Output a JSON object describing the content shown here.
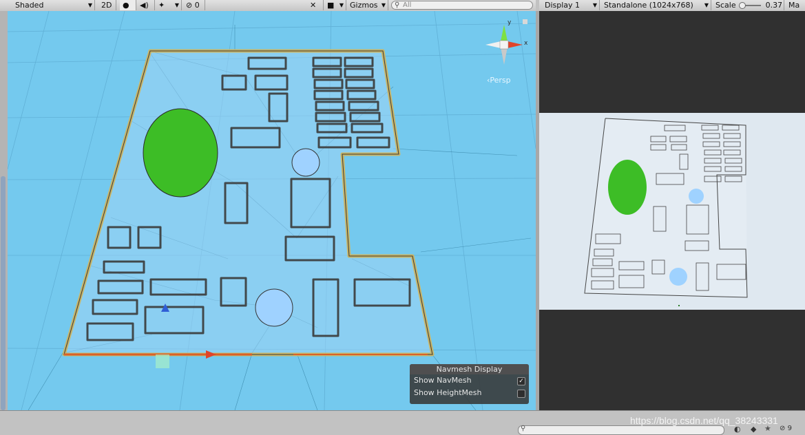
{
  "toolbar": {
    "shading_mode": "Shaded",
    "mode_2d": "2D",
    "hidden_count": "0",
    "gizmos_label": "Gizmos",
    "search_placeholder": "All"
  },
  "game_toolbar": {
    "display": "Display 1",
    "resolution": "Standalone (1024x768)",
    "scale_label": "Scale",
    "scale_value": "0.37",
    "maximize_label": "Ma"
  },
  "scene": {
    "persp_label": "Persp",
    "axis_x": "x",
    "axis_y": "y"
  },
  "navmesh_overlay": {
    "title": "Navmesh Display",
    "show_navmesh_label": "Show NavMesh",
    "show_navmesh_checked": true,
    "show_heightmesh_label": "Show HeightMesh",
    "show_heightmesh_checked": false
  },
  "bottom_bar": {
    "layer_count": "9"
  },
  "watermark": "https://blog.csdn.net/qq_38243331",
  "colors": {
    "scene_background": "#74c9ee",
    "floor": "#a8d8ff",
    "green_area": "#3dbd26",
    "blue_area": "#9fd2ff",
    "walls": "#d8d8d8",
    "game_background": "#dfe8f0"
  }
}
